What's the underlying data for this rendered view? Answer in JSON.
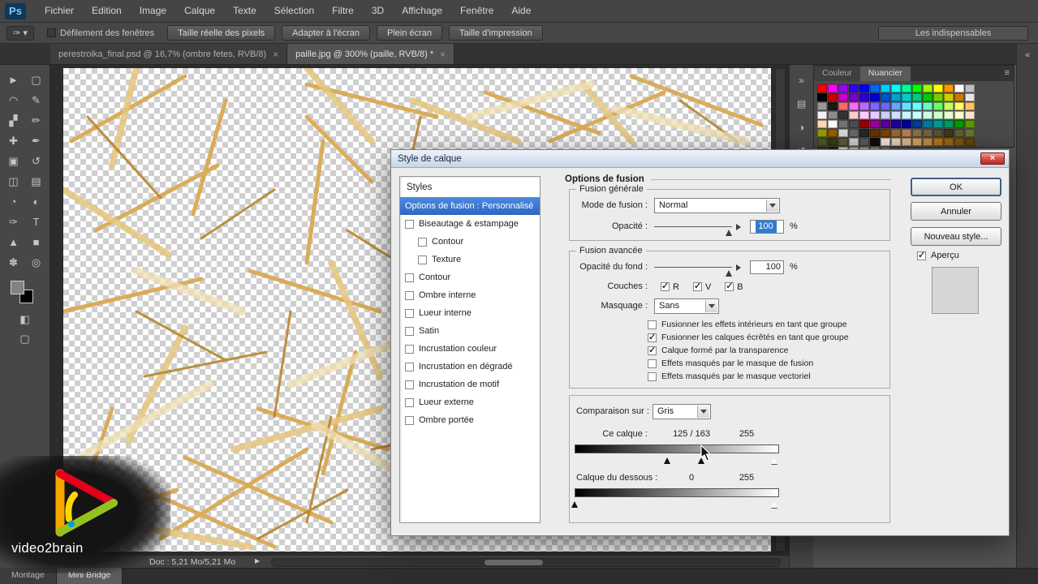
{
  "menubar": {
    "logo": "Ps",
    "items": [
      "Fichier",
      "Edition",
      "Image",
      "Calque",
      "Texte",
      "Sélection",
      "Filtre",
      "3D",
      "Affichage",
      "Fenêtre",
      "Aide"
    ]
  },
  "optionsbar": {
    "scroll_checkbox_label": "Défilement des fenêtres",
    "buttons": [
      "Taille réelle des pixels",
      "Adapter à l'écran",
      "Plein écran",
      "Taille d'impression"
    ],
    "workspace_selector": "Les indispensables"
  },
  "icons": {
    "tool_preset": "✑",
    "caret": "▾",
    "panel_menu": "≡",
    "status_arrow": "▶",
    "collapse": "«"
  },
  "document_tabs": [
    {
      "label": "perestroika_final.psd @ 16,7% (ombre fetes, RVB/8)",
      "close": "×"
    },
    {
      "label": "paille.jpg @ 300% (paille, RVB/8) *",
      "close": "×"
    }
  ],
  "toolbar": {
    "tools": [
      {
        "name": "tool-move",
        "glyph": "►"
      },
      {
        "name": "tool-marquee",
        "glyph": "▢"
      },
      {
        "name": "tool-lasso",
        "glyph": "◠"
      },
      {
        "name": "tool-quick-select",
        "glyph": "✎"
      },
      {
        "name": "tool-crop",
        "glyph": "▞"
      },
      {
        "name": "tool-eyedropper",
        "glyph": "✏"
      },
      {
        "name": "tool-healing",
        "glyph": "✚"
      },
      {
        "name": "tool-brush",
        "glyph": "✒"
      },
      {
        "name": "tool-clone-stamp",
        "glyph": "▣"
      },
      {
        "name": "tool-history-brush",
        "glyph": "↺"
      },
      {
        "name": "tool-eraser",
        "glyph": "◫"
      },
      {
        "name": "tool-gradient",
        "glyph": "▤"
      },
      {
        "name": "tool-blur",
        "glyph": "◔"
      },
      {
        "name": "tool-dodge",
        "glyph": "◐"
      },
      {
        "name": "tool-pen",
        "glyph": "✑"
      },
      {
        "name": "tool-type",
        "glyph": "T"
      },
      {
        "name": "tool-path-select",
        "glyph": "▲"
      },
      {
        "name": "tool-shape",
        "glyph": "■"
      },
      {
        "name": "tool-hand",
        "glyph": "✽"
      },
      {
        "name": "tool-zoom",
        "glyph": "◎"
      }
    ],
    "extra": [
      {
        "name": "quick-mask-icon",
        "glyph": "◧"
      },
      {
        "name": "screen-mode-icon",
        "glyph": "▢"
      }
    ]
  },
  "right_panel": {
    "tabs": [
      "Couleur",
      "Nuancier"
    ],
    "strip_icons": [
      {
        "name": "collapse-panels-icon",
        "glyph": "»"
      },
      {
        "name": "color-panel-icon",
        "glyph": "▤"
      },
      {
        "name": "adjustments-panel-icon",
        "glyph": "◑"
      },
      {
        "name": "history-panel-icon",
        "glyph": "↺"
      },
      {
        "name": "properties-panel-icon",
        "glyph": "≡"
      }
    ],
    "swatches": [
      "#ff0000",
      "#ff00ff",
      "#9900ff",
      "#3300ff",
      "#0000ff",
      "#0066ff",
      "#00ccff",
      "#00ffff",
      "#00ff99",
      "#00ff00",
      "#99ff00",
      "#ffff00",
      "#ff9900",
      "#ffffff",
      "#bfbfbf",
      "#000000",
      "#cc0000",
      "#cc00cc",
      "#7a00cc",
      "#2900cc",
      "#0000cc",
      "#0052cc",
      "#00a3cc",
      "#00cccc",
      "#00cc7a",
      "#00cc00",
      "#7acc00",
      "#cccc00",
      "#cc7a00",
      "#e6e6e6",
      "#999999",
      "#1a1a1a",
      "#ff6666",
      "#ff66ff",
      "#c266ff",
      "#7a66ff",
      "#6666ff",
      "#66a3ff",
      "#66e0ff",
      "#66ffff",
      "#66ffc2",
      "#66ff66",
      "#c2ff66",
      "#ffff66",
      "#ffc266",
      "#f2f2f2",
      "#8c8c8c",
      "#333333",
      "#ffcccc",
      "#ffccff",
      "#e6ccff",
      "#ccccff",
      "#cce0ff",
      "#ccf5ff",
      "#ccffff",
      "#ccffe6",
      "#ccffcc",
      "#e6ffcc",
      "#ffffcc",
      "#ffe6cc",
      "#ffd9b3",
      "#fafafa",
      "#737373",
      "#4d4d4d",
      "#990000",
      "#990099",
      "#5c0099",
      "#1f0099",
      "#000099",
      "#003d99",
      "#007a99",
      "#009999",
      "#00995c",
      "#009900",
      "#5c9900",
      "#999900",
      "#995c00",
      "#d9d9d9",
      "#666666",
      "#262626",
      "#663300",
      "#804000",
      "#996633",
      "#b38059",
      "#8c6d4d",
      "#736040",
      "#595030",
      "#403520",
      "#605c30",
      "#6b7339",
      "#4d5926",
      "#333d1a",
      "#5c5c3d",
      "#cccccc",
      "#595959",
      "#0d0d0d",
      "#f2e6d9",
      "#e6cfb3",
      "#d9b88c",
      "#cca166",
      "#bf8a40",
      "#b37319",
      "#996614",
      "#80550f",
      "#66440a",
      "#4d3305",
      "#332200",
      "#d9d2c5",
      "#bfb8a8",
      "#a6a090",
      "#8c877a",
      "#737066"
    ]
  },
  "dialog": {
    "title": "Style de calque",
    "close": "×",
    "styles_list": {
      "header": "Styles",
      "selected": "Options de fusion : Personnalisé",
      "items": [
        {
          "label": "Biseautage & estampage",
          "checked": false,
          "indent": 0
        },
        {
          "label": "Contour",
          "checked": false,
          "indent": 1
        },
        {
          "label": "Texture",
          "checked": false,
          "indent": 1
        },
        {
          "label": "Contour",
          "checked": false,
          "indent": 0
        },
        {
          "label": "Ombre interne",
          "checked": false,
          "indent": 0
        },
        {
          "label": "Lueur interne",
          "checked": false,
          "indent": 0
        },
        {
          "label": "Satin",
          "checked": false,
          "indent": 0
        },
        {
          "label": "Incrustation couleur",
          "checked": false,
          "indent": 0
        },
        {
          "label": "Incrustation en dégradé",
          "checked": false,
          "indent": 0
        },
        {
          "label": "Incrustation de motif",
          "checked": false,
          "indent": 0
        },
        {
          "label": "Lueur externe",
          "checked": false,
          "indent": 0
        },
        {
          "label": "Ombre portée",
          "checked": false,
          "indent": 0
        }
      ]
    },
    "section_title": "Options de fusion",
    "general": {
      "group_label": "Fusion générale",
      "blend_mode_label": "Mode de fusion :",
      "blend_mode_value": "Normal",
      "opacity_label": "Opacité :",
      "opacity_value": "100",
      "opacity_unit": "%"
    },
    "advanced": {
      "group_label": "Fusion avancée",
      "fill_opacity_label": "Opacité du fond :",
      "fill_opacity_value": "100",
      "fill_opacity_unit": "%",
      "channels_label": "Couches :",
      "channels": [
        {
          "label": "R",
          "checked": true
        },
        {
          "label": "V",
          "checked": true
        },
        {
          "label": "B",
          "checked": true
        }
      ],
      "knockout_label": "Masquage :",
      "knockout_value": "Sans",
      "options": [
        {
          "label": "Fusionner les effets intérieurs en tant que groupe",
          "checked": false
        },
        {
          "label": "Fusionner les calques écrêtés en tant que groupe",
          "checked": true
        },
        {
          "label": "Calque formé par la transparence",
          "checked": true
        },
        {
          "label": "Effets masqués par le masque de fusion",
          "checked": false
        },
        {
          "label": "Effets masqués par le masque vectoriel",
          "checked": false
        }
      ]
    },
    "blend_if": {
      "compare_label": "Comparaison sur :",
      "compare_value": "Gris",
      "this_layer_label": "Ce calque :",
      "this_layer_values": "125  /  163",
      "this_layer_max": "255",
      "underlying_label": "Calque du dessous :",
      "underlying_low": "0",
      "underlying_max": "255"
    },
    "buttons": {
      "ok": "OK",
      "cancel": "Annuler",
      "new_style": "Nouveau style...",
      "preview_label": "Aperçu"
    }
  },
  "statusbar": {
    "doc_info": "Doc : 5,21 Mo/5,21 Mo"
  },
  "bottom_tabs": [
    "Montage",
    "Mini Bridge"
  ],
  "branding": {
    "name": "video2brain"
  }
}
